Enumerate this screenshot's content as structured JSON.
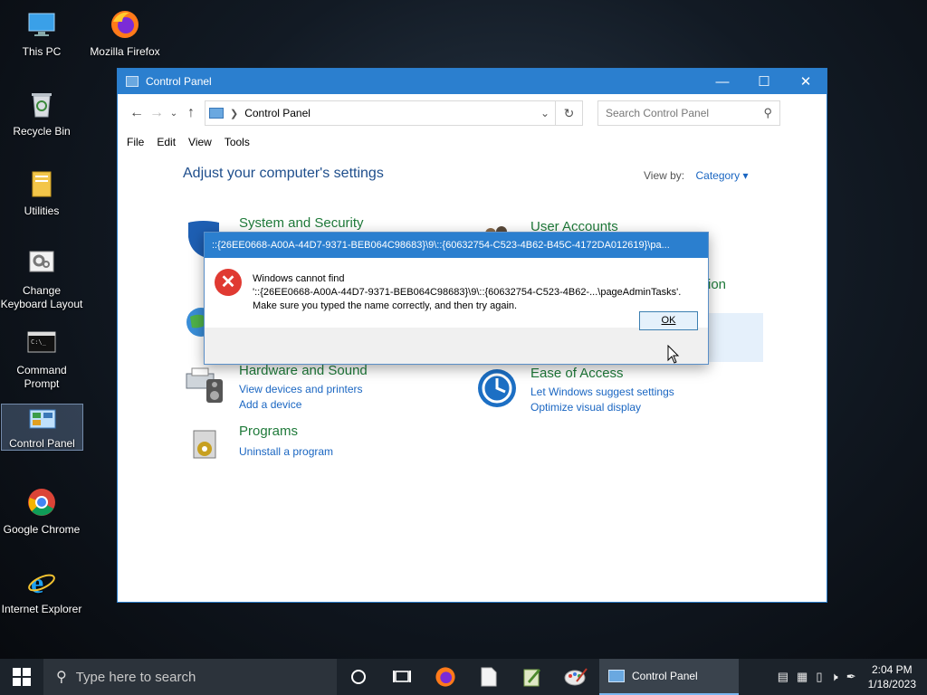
{
  "desktop": {
    "icons": [
      {
        "label": "This PC"
      },
      {
        "label": "Mozilla Firefox"
      },
      {
        "label": "Recycle Bin"
      },
      {
        "label": "Utilities"
      },
      {
        "label": "Change Keyboard Layout"
      },
      {
        "label": "Command Prompt"
      },
      {
        "label": "Control Panel"
      },
      {
        "label": "Google Chrome"
      },
      {
        "label": "Internet Explorer"
      }
    ]
  },
  "window": {
    "title": "Control Panel",
    "address": "Control Panel",
    "search_placeholder": "Search Control Panel",
    "menu": [
      "File",
      "Edit",
      "View",
      "Tools"
    ],
    "heading": "Adjust your computer's settings",
    "view_by_label": "View by:",
    "view_by_value": "Category",
    "categories": {
      "system": {
        "title": "System and Security"
      },
      "accounts": {
        "title": "User Accounts",
        "partial": "ion"
      },
      "hardware": {
        "title": "Hardware and Sound",
        "links": [
          "View devices and printers",
          "Add a device"
        ]
      },
      "ease": {
        "title": "Ease of Access",
        "links": [
          "Let Windows suggest settings",
          "Optimize visual display"
        ]
      },
      "programs": {
        "title": "Programs",
        "links": [
          "Uninstall a program"
        ]
      }
    }
  },
  "dialog": {
    "title": "::{26EE0668-A00A-44D7-9371-BEB064C98683}\\9\\::{60632754-C523-4B62-B45C-4172DA012619}\\pa...",
    "line1": "Windows cannot find",
    "line2": "'::{26EE0668-A00A-44D7-9371-BEB064C98683}\\9\\::{60632754-C523-4B62-...\\pageAdminTasks'.",
    "line3": "Make sure you typed the name correctly, and then try again.",
    "ok_label": "OK"
  },
  "taskbar": {
    "search_placeholder": "Type here to search",
    "active_app": "Control Panel",
    "time": "2:04 PM",
    "date": "1/18/2023"
  },
  "colors": {
    "titlebar": "#2b7fcf",
    "link": "#1a66c2",
    "category_title": "#1f7a3a",
    "error": "#e03a32"
  }
}
